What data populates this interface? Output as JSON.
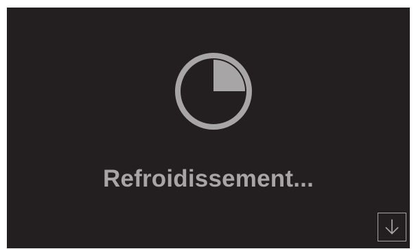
{
  "status": {
    "text": "Refroidissement...",
    "progress_fraction": 0.25,
    "icon": "progress-pie-icon"
  },
  "controls": {
    "scroll_down_icon": "arrow-down-icon"
  },
  "colors": {
    "background": "#231f20",
    "foreground": "#a7a5a6"
  }
}
